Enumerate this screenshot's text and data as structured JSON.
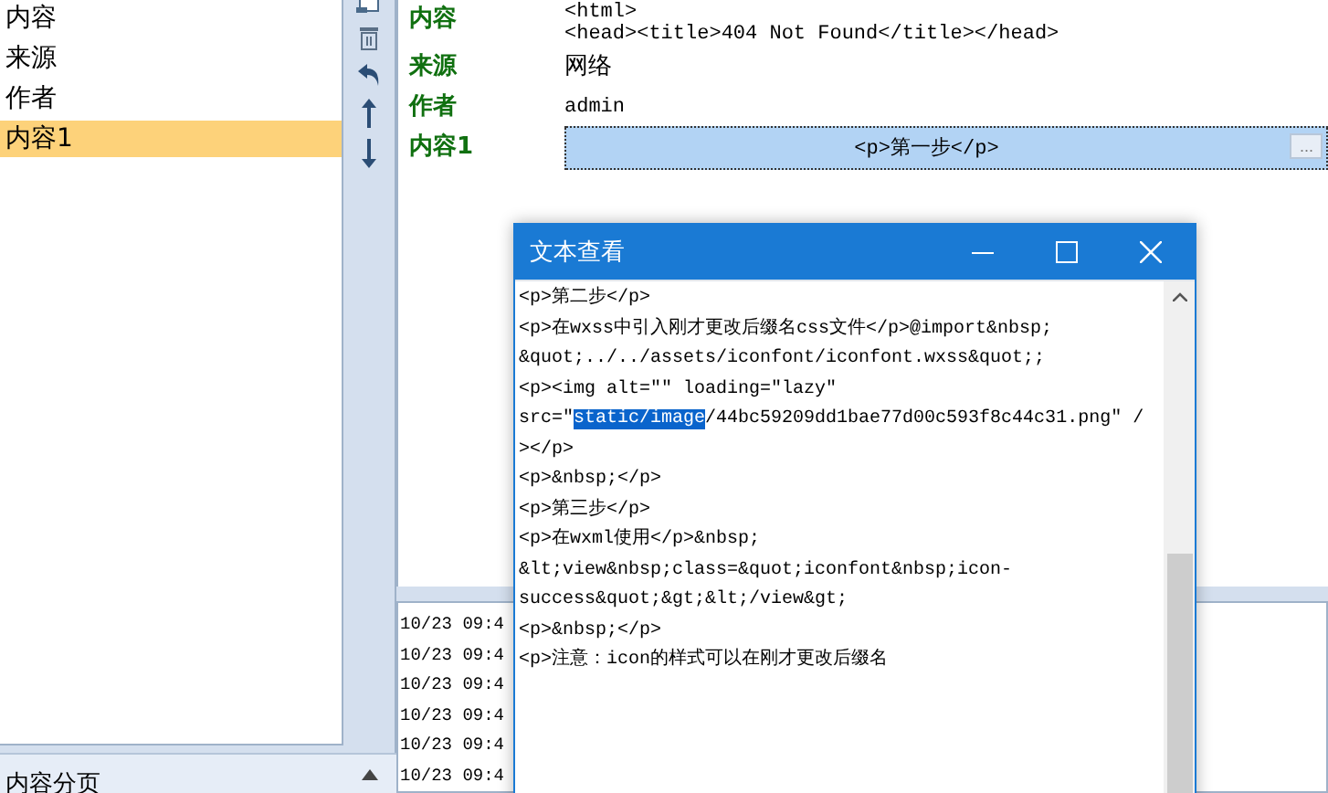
{
  "item_list": {
    "items": [
      {
        "label": "内容",
        "selected": false
      },
      {
        "label": "来源",
        "selected": false
      },
      {
        "label": "作者",
        "selected": false
      },
      {
        "label": "内容1",
        "selected": true
      }
    ]
  },
  "section_header": {
    "title": "内容分页",
    "expanded": true
  },
  "properties": [
    {
      "label": "内容",
      "value_lines": [
        "<html>",
        "<head><title>404 Not Found</title></head>"
      ],
      "selected": false
    },
    {
      "label": "来源",
      "value_lines": [
        "网络"
      ],
      "selected": false
    },
    {
      "label": "作者",
      "value_lines": [
        "admin"
      ],
      "selected": false
    },
    {
      "label": "内容1",
      "value_lines": [
        "<p>第一步</p>"
      ],
      "selected": true,
      "button": "..."
    }
  ],
  "log": {
    "rows": [
      "10/23 09:4",
      "10/23 09:4",
      "10/23 09:4",
      "10/23 09:4",
      "10/23 09:4",
      "10/23 09:4"
    ]
  },
  "dialog": {
    "title": "文本查看",
    "lines": [
      {
        "segments": [
          {
            "text": "<p>第二步</p>",
            "selected": false
          }
        ]
      },
      {
        "segments": [
          {
            "text": "<p>在wxss中引入刚才更改后缀名css文件</p>@import&nbsp;",
            "selected": false
          }
        ]
      },
      {
        "segments": [
          {
            "text": "&quot;../../assets/iconfont/iconfont.wxss&quot;;",
            "selected": false
          }
        ]
      },
      {
        "segments": [
          {
            "text": "<p><img alt=\"\" loading=\"lazy\"",
            "selected": false
          }
        ]
      },
      {
        "segments": [
          {
            "text": "src=\"",
            "selected": false
          },
          {
            "text": "static/image",
            "selected": true
          },
          {
            "text": "/44bc59209dd1bae77d00c593f8c44c31.png\" /",
            "selected": false
          }
        ]
      },
      {
        "segments": [
          {
            "text": "></p>",
            "selected": false
          }
        ]
      },
      {
        "segments": [
          {
            "text": "<p>&nbsp;</p>",
            "selected": false
          }
        ]
      },
      {
        "segments": [
          {
            "text": "<p>第三步</p>",
            "selected": false
          }
        ]
      },
      {
        "segments": [
          {
            "text": "<p>在wxml使用</p>&nbsp;",
            "selected": false
          }
        ]
      },
      {
        "segments": [
          {
            "text": "&lt;view&nbsp;class=&quot;iconfont&nbsp;icon-",
            "selected": false
          }
        ]
      },
      {
        "segments": [
          {
            "text": "success&quot;&gt;&lt;/view&gt;",
            "selected": false
          }
        ]
      },
      {
        "segments": [
          {
            "text": "<p>&nbsp;</p>",
            "selected": false
          }
        ]
      },
      {
        "segments": [
          {
            "text": "<p>注意：icon的样式可以在刚才更改后缀名",
            "selected": false
          }
        ]
      }
    ]
  }
}
